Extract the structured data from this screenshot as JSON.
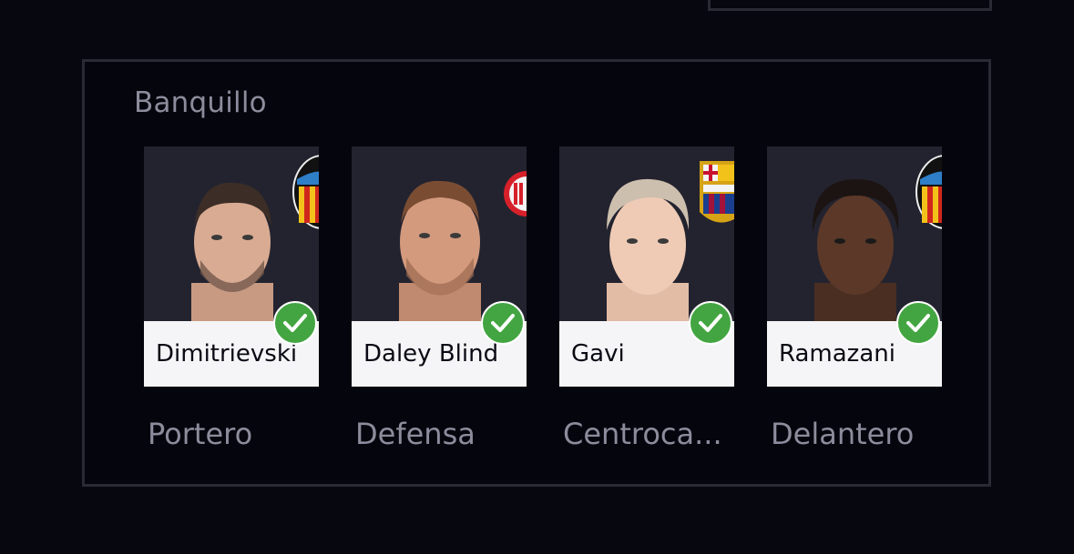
{
  "bench": {
    "title": "Banquillo",
    "players": [
      {
        "name": "Dimitrievski",
        "position": "Portero",
        "club_crest": "valencia-crest",
        "selected": true
      },
      {
        "name": "Daley Blind",
        "position": "Defensa",
        "club_crest": "girona-crest",
        "selected": true
      },
      {
        "name": "Gavi",
        "position": "Centroca...",
        "club_crest": "barcelona-crest",
        "selected": true
      },
      {
        "name": "Ramazani",
        "position": "Delantero",
        "club_crest": "valencia-crest",
        "selected": true
      }
    ]
  },
  "colors": {
    "background": "#07070f",
    "panel_border": "#2a2a35",
    "photo_bg": "#23232f",
    "check_green": "#43a541",
    "muted_text": "#8c8c9c"
  },
  "icons": {
    "selected": "check-icon"
  }
}
